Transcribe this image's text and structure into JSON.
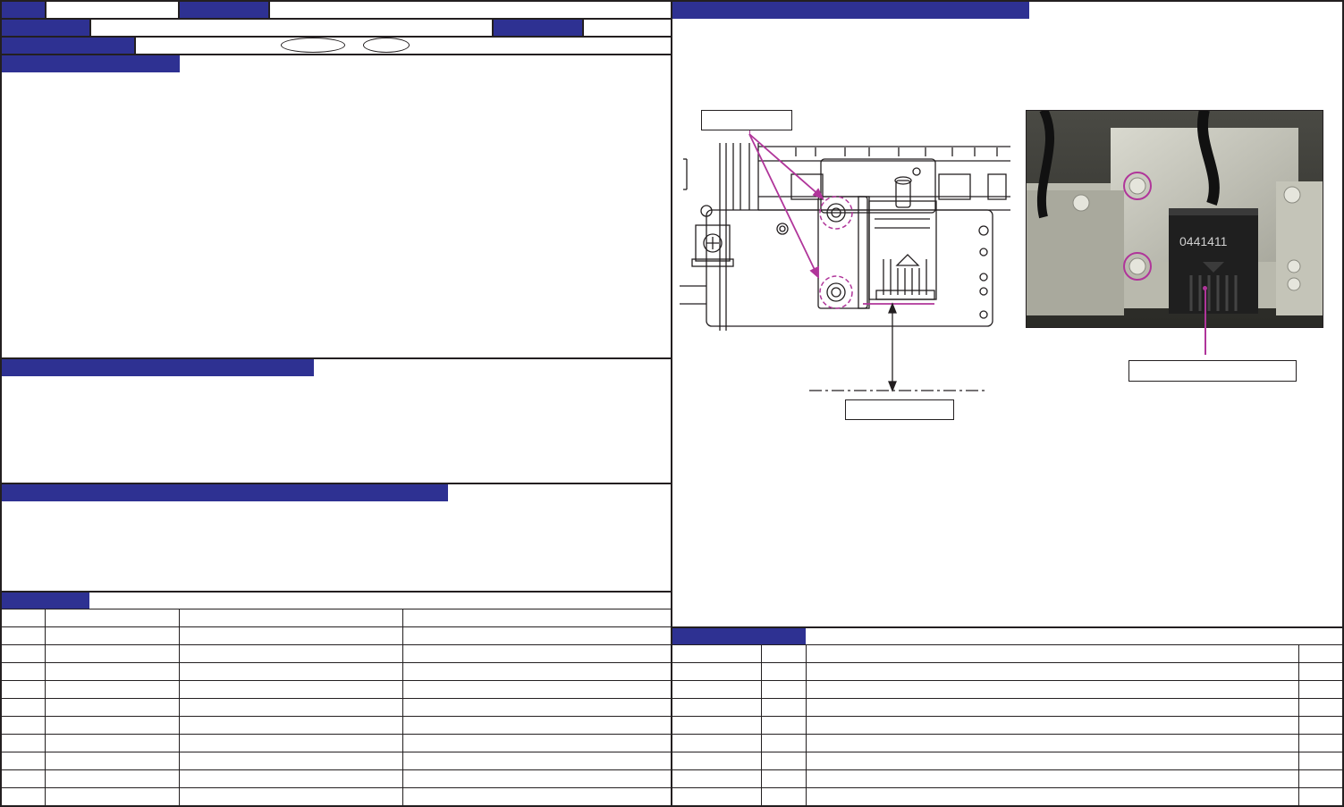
{
  "header": {
    "row1_cells": [
      "",
      "",
      "",
      ""
    ],
    "row2_cells": [
      "",
      "",
      "",
      ""
    ],
    "row3_cells": [
      "",
      ""
    ],
    "ovals": [
      "",
      ""
    ]
  },
  "sections": {
    "section1_title": "",
    "section2_title": "",
    "section3_title": "",
    "section4_title": "",
    "figure_title": "",
    "parts_title": ""
  },
  "figure": {
    "callout_screws": "",
    "callout_dimension": "",
    "callout_part": "",
    "photo_part_number": "0441411"
  },
  "colors": {
    "navy": "#2e3192",
    "magenta": "#b0359a",
    "border": "#231f20"
  },
  "left_table": {
    "columns": 4,
    "rows": 10
  },
  "right_table": {
    "columns": 4,
    "rows": 8
  }
}
